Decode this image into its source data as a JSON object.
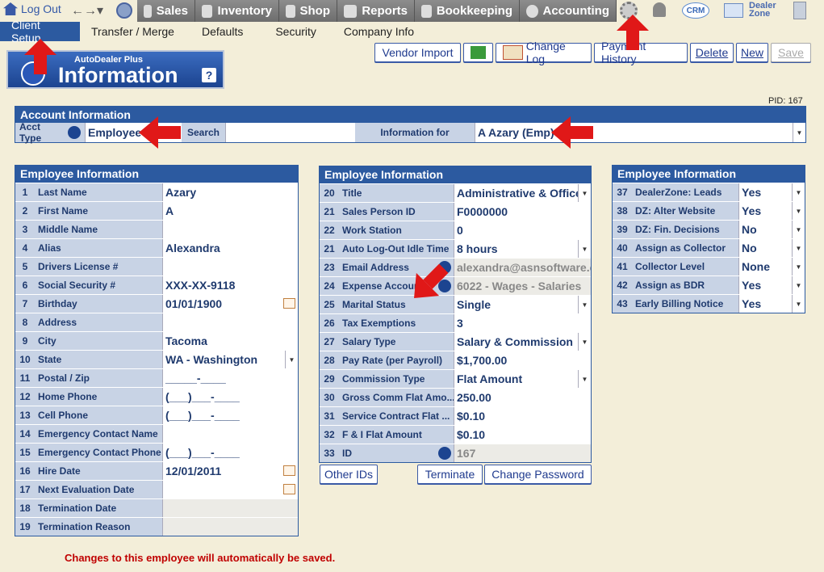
{
  "topnav": {
    "logout": "Log Out",
    "items": [
      "Sales",
      "Inventory",
      "Shop",
      "Reports",
      "Bookkeeping",
      "Accounting"
    ],
    "crm": "CRM",
    "dealer_zone_1": "Dealer",
    "dealer_zone_2": "Zone"
  },
  "subnav": [
    "Client Setup",
    "Transfer / Merge",
    "Defaults",
    "Security",
    "Company Info"
  ],
  "logo": {
    "line1": "AutoDealer Plus",
    "line2": "Information",
    "help": "?"
  },
  "toolbar": {
    "vendor_import": "Vendor Import",
    "change_log": "Change Log",
    "payment_history": "Payment History",
    "delete": "Delete",
    "new": "New",
    "save": "Save"
  },
  "pid": "PID: 167",
  "account": {
    "header": "Account Information",
    "acct_type_label": "Acct Type",
    "acct_type_value": "Employee",
    "search_label": "Search",
    "info_for_label": "Information for",
    "info_for_value": "A Azary (Emp)"
  },
  "panel_left": {
    "header": "Employee Information",
    "rows": [
      {
        "n": "1",
        "label": "Last Name",
        "value": "Azary"
      },
      {
        "n": "2",
        "label": "First Name",
        "value": "A"
      },
      {
        "n": "3",
        "label": "Middle Name",
        "value": ""
      },
      {
        "n": "4",
        "label": "Alias",
        "value": "Alexandra"
      },
      {
        "n": "5",
        "label": "Drivers License #",
        "value": ""
      },
      {
        "n": "6",
        "label": "Social Security #",
        "value": "XXX-XX-9118"
      },
      {
        "n": "7",
        "label": "Birthday",
        "value": "01/01/1900"
      },
      {
        "n": "8",
        "label": "Address",
        "value": ""
      },
      {
        "n": "9",
        "label": "City",
        "value": "Tacoma"
      },
      {
        "n": "10",
        "label": "State",
        "value": "WA - Washington"
      },
      {
        "n": "11",
        "label": "Postal / Zip",
        "value": "_____-____"
      },
      {
        "n": "12",
        "label": "Home Phone",
        "value": "(___)___-____"
      },
      {
        "n": "13",
        "label": "Cell Phone",
        "value": "(___)___-____"
      },
      {
        "n": "14",
        "label": "Emergency Contact Name",
        "value": ""
      },
      {
        "n": "15",
        "label": "Emergency Contact Phone",
        "value": "(___)___-____"
      },
      {
        "n": "16",
        "label": "Hire Date",
        "value": "12/01/2011"
      },
      {
        "n": "17",
        "label": "Next Evaluation Date",
        "value": ""
      },
      {
        "n": "18",
        "label": "Termination Date",
        "value": ""
      },
      {
        "n": "19",
        "label": "Termination Reason",
        "value": ""
      }
    ]
  },
  "panel_mid": {
    "header": "Employee Information",
    "rows": [
      {
        "n": "20",
        "label": "Title",
        "value": "Administrative & Office"
      },
      {
        "n": "21",
        "label": "Sales Person ID",
        "value": "F0000000"
      },
      {
        "n": "22",
        "label": "Work Station",
        "value": "0"
      },
      {
        "n": "21",
        "label": "Auto Log-Out Idle Time",
        "value": "8 hours"
      },
      {
        "n": "23",
        "label": "Email Address",
        "value": "alexandra@asnsoftware.co"
      },
      {
        "n": "24",
        "label": "Expense Account",
        "value": "6022 - Wages - Salaries"
      },
      {
        "n": "25",
        "label": "Marital Status",
        "value": "Single"
      },
      {
        "n": "26",
        "label": "Tax Exemptions",
        "value": "3"
      },
      {
        "n": "27",
        "label": "Salary Type",
        "value": "Salary & Commission"
      },
      {
        "n": "28",
        "label": "Pay Rate (per Payroll)",
        "value": "$1,700.00"
      },
      {
        "n": "29",
        "label": "Commission Type",
        "value": "Flat Amount"
      },
      {
        "n": "30",
        "label": "Gross Comm Flat Amo...",
        "value": "250.00"
      },
      {
        "n": "31",
        "label": "Service Contract Flat ...",
        "value": "$0.10"
      },
      {
        "n": "32",
        "label": "F & I Flat Amount",
        "value": "$0.10"
      },
      {
        "n": "33",
        "label": "ID",
        "value": "167"
      }
    ],
    "other_ids": "Other IDs",
    "terminate": "Terminate",
    "change_password": "Change Password"
  },
  "panel_right": {
    "header": "Employee Information",
    "rows": [
      {
        "n": "37",
        "label": "DealerZone:  Leads",
        "value": "Yes"
      },
      {
        "n": "38",
        "label": "DZ: Alter Website",
        "value": "Yes"
      },
      {
        "n": "39",
        "label": "DZ:  Fin. Decisions",
        "value": "No"
      },
      {
        "n": "40",
        "label": "Assign as Collector",
        "value": "No"
      },
      {
        "n": "41",
        "label": "Collector Level",
        "value": "None"
      },
      {
        "n": "42",
        "label": "Assign as BDR",
        "value": "Yes"
      },
      {
        "n": "43",
        "label": "Early Billing Notice",
        "value": "Yes"
      }
    ]
  },
  "notice": "Changes to this employee will automatically be saved."
}
